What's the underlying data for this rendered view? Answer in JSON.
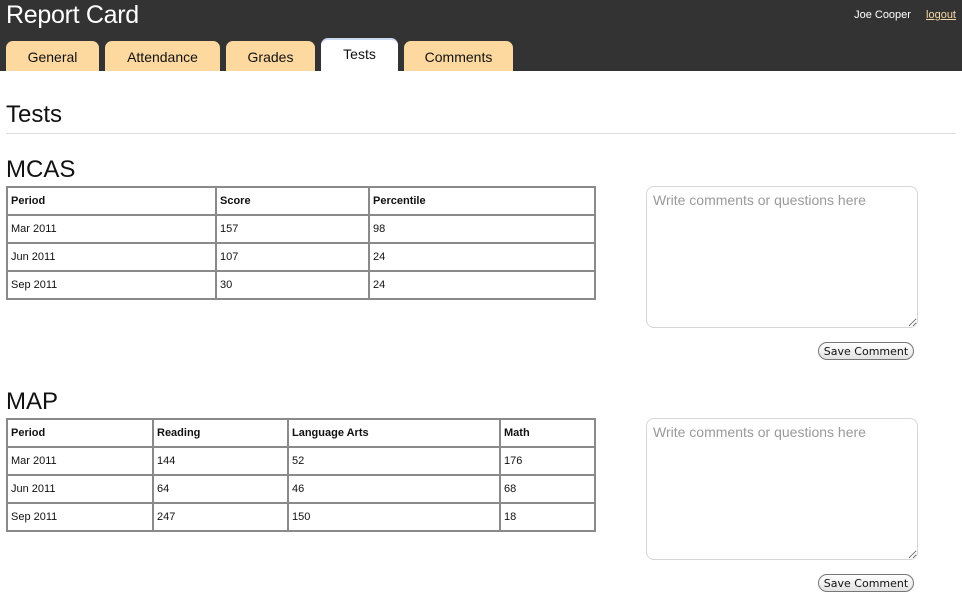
{
  "header": {
    "title": "Report Card",
    "user_name": "Joe Cooper",
    "logout_label": "logout"
  },
  "tabs": [
    {
      "label": "General",
      "active": false
    },
    {
      "label": "Attendance",
      "active": false
    },
    {
      "label": "Grades",
      "active": false
    },
    {
      "label": "Tests",
      "active": true
    },
    {
      "label": "Comments",
      "active": false
    }
  ],
  "page_title": "Tests",
  "sections": [
    {
      "title": "MCAS",
      "columns": [
        "Period",
        "Score",
        "Percentile"
      ],
      "rows": [
        [
          "Mar 2011",
          "157",
          "98"
        ],
        [
          "Jun 2011",
          "107",
          "24"
        ],
        [
          "Sep 2011",
          "30",
          "24"
        ]
      ],
      "comment_placeholder": "Write comments or questions here",
      "comment_value": "",
      "save_label": "Save Comment"
    },
    {
      "title": "MAP",
      "columns": [
        "Period",
        "Reading",
        "Language Arts",
        "Math"
      ],
      "rows": [
        [
          "Mar 2011",
          "144",
          "52",
          "176"
        ],
        [
          "Jun 2011",
          "64",
          "46",
          "68"
        ],
        [
          "Sep 2011",
          "247",
          "150",
          "18"
        ]
      ],
      "comment_placeholder": "Write comments or questions here",
      "comment_value": "",
      "save_label": "Save Comment"
    }
  ],
  "colors": {
    "header_bg": "#333333",
    "tab_bg": "#fdd9a0",
    "active_tab_bg": "#ffffff",
    "logout_link": "#f7d9a8"
  }
}
